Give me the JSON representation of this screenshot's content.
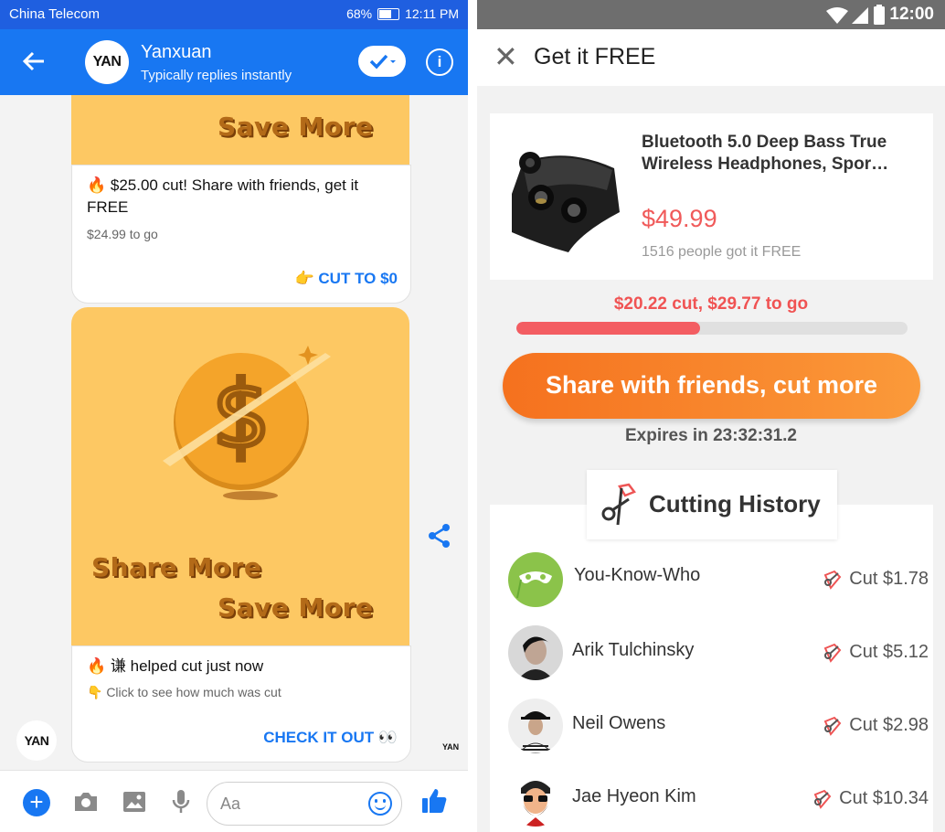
{
  "left": {
    "status": {
      "carrier": "China Telecom",
      "battery": "68%",
      "time": "12:11 PM"
    },
    "header": {
      "name": "Yanxuan",
      "subtitle": "Typically replies instantly",
      "avatar_text": "YAN"
    },
    "cards": [
      {
        "promo_line2": "Save More",
        "title": "🔥 $25.00 cut! Share with friends, get it FREE",
        "sub": "$24.99 to go",
        "cta": "👉 CUT TO $0"
      },
      {
        "promo_line1": "Share More",
        "promo_line2": "Save More",
        "title": "🔥 谦 helped cut just now",
        "sub": "👇 Click to see how much was cut",
        "cta": "CHECK IT OUT 👀"
      }
    ],
    "bot_avatar_text": "YAN",
    "composer": {
      "placeholder": "Aa"
    },
    "colors": {
      "messenger_blue": "#1877f2",
      "promo_bg": "#fdc863"
    }
  },
  "right": {
    "status": {
      "time": "12:00"
    },
    "appbar": {
      "title": "Get it FREE"
    },
    "product": {
      "name": "Bluetooth 5.0 Deep Bass True Wireless Headphones, Spor…",
      "price": "$49.99",
      "people": "1516 people got it FREE"
    },
    "progress": {
      "label": "$20.22 cut, $29.77 to go",
      "fraction": 0.47
    },
    "share_button": "Share with friends, cut more",
    "expires": "Expires in 23:32:31.2",
    "history": {
      "title": "Cutting History",
      "rows": [
        {
          "name": "You-Know-Who",
          "cut": "Cut $1.78",
          "avatar": "mask"
        },
        {
          "name": "Arik Tulchinsky",
          "cut": "Cut $5.12",
          "avatar": "photo-dark"
        },
        {
          "name": "Neil Owens",
          "cut": "Cut $2.98",
          "avatar": "hat"
        },
        {
          "name": "Jae Hyeon Kim",
          "cut": "Cut $10.34",
          "avatar": "beard"
        }
      ]
    },
    "colors": {
      "accent_red": "#f05a5a",
      "button_orange": "#f5711e"
    }
  }
}
